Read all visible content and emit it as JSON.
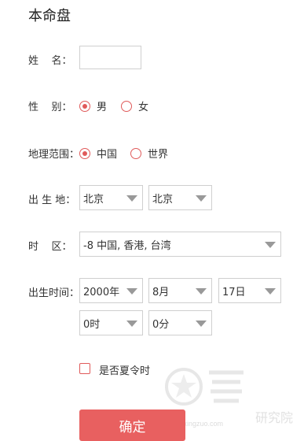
{
  "title": "本命盘",
  "name_row": {
    "label": "姓    名：",
    "value": ""
  },
  "gender_row": {
    "label": "性    别：",
    "options": [
      {
        "label": "男",
        "selected": true
      },
      {
        "label": "女",
        "selected": false
      }
    ]
  },
  "region_row": {
    "label": "地理范围：",
    "options": [
      {
        "label": "中国",
        "selected": true
      },
      {
        "label": "世界",
        "selected": false
      }
    ]
  },
  "birthplace_row": {
    "label": "出 生 地：",
    "province": "北京",
    "city": "北京"
  },
  "timezone_row": {
    "label": "时    区：",
    "value": "-8 中国, 香港, 台湾"
  },
  "birthtime_row": {
    "label": "出生时间：",
    "year": "2000年",
    "month": "8月",
    "day": "17日",
    "hour": "0时",
    "minute": "0分"
  },
  "dst": {
    "label": "是否夏令时",
    "checked": false
  },
  "submit_label": "确定",
  "watermark": {
    "url": "www.xingzuo.com",
    "text": "研究院"
  },
  "colors": {
    "accent": "#e05a5a",
    "button": "#e86060"
  }
}
